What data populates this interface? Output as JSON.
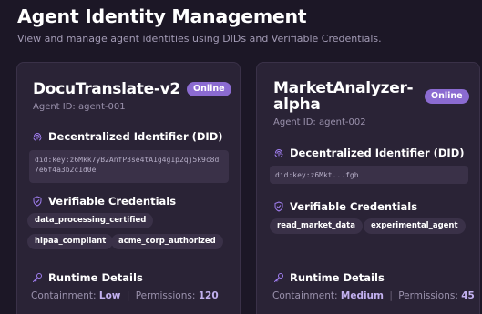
{
  "header": {
    "title": "Agent Identity Management",
    "subtitle": "View and manage agent identities using DIDs and Verifiable Credentials."
  },
  "sections": {
    "did": "Decentralized Identifier (DID)",
    "credentials": "Verifiable Credentials",
    "runtime": "Runtime Details",
    "containment_label": "Containment:",
    "permissions_label": "Permissions:",
    "separator": "|"
  },
  "agents": [
    {
      "name": "DocuTranslate-v2",
      "status": "Online",
      "agent_id": "Agent ID: agent-001",
      "did": "did:key:z6Mkk7yB2AnfP3se4tA1g4g1p2qj5k9c8d7e6f4a3b2c1d0e",
      "credentials": [
        "data_processing_certified",
        "hipaa_compliant",
        "acme_corp_authorized"
      ],
      "containment": "Low",
      "permissions": "120"
    },
    {
      "name": "MarketAnalyzer-alpha",
      "status": "Online",
      "agent_id": "Agent ID: agent-002",
      "did": "did:key:z6Mkt...fgh",
      "credentials": [
        "read_market_data",
        "experimental_agent"
      ],
      "containment": "Medium",
      "permissions": "45"
    }
  ],
  "colors": {
    "background": "#1c1726",
    "card": "#2a2336",
    "accent": "#8b6bd1",
    "accent_text": "#c2b0ef"
  }
}
